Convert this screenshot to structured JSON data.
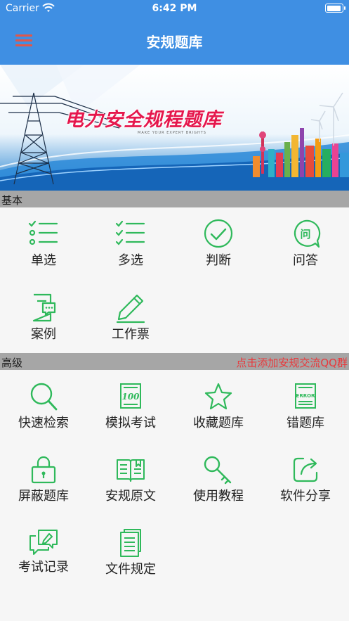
{
  "status_bar": {
    "carrier": "Carrier",
    "time": "6:42 PM",
    "battery_level": 0.95
  },
  "nav": {
    "title": "安规题库",
    "menu_icon": "hamburger-menu-icon"
  },
  "banner": {
    "title": "电力安全规程题库",
    "subtitle": "MAKE YOUR EXPERT BRIGHTS"
  },
  "colors": {
    "nav_blue": "#3f8fe3",
    "icon_green": "#2fb95b",
    "section_gray": "#a6a6a6",
    "link_red": "#e8393c"
  },
  "basic": {
    "header": "基本",
    "items": [
      {
        "label": "单选",
        "icon": "single-choice-list-icon"
      },
      {
        "label": "多选",
        "icon": "multi-choice-list-icon"
      },
      {
        "label": "判断",
        "icon": "check-circle-icon"
      },
      {
        "label": "问答",
        "icon": "question-bubble-icon"
      },
      {
        "label": "案例",
        "icon": "case-document-icon"
      },
      {
        "label": "工作票",
        "icon": "pencil-edit-icon"
      }
    ]
  },
  "advanced": {
    "header": "高级",
    "link": "点击添加安规交流QQ群",
    "items": [
      {
        "label": "快速检索",
        "icon": "search-icon"
      },
      {
        "label": "模拟考试",
        "icon": "exam-score-icon"
      },
      {
        "label": "收藏题库",
        "icon": "star-icon"
      },
      {
        "label": "错题库",
        "icon": "error-book-icon"
      },
      {
        "label": "屏蔽题库",
        "icon": "lock-icon"
      },
      {
        "label": "安规原文",
        "icon": "open-book-icon"
      },
      {
        "label": "使用教程",
        "icon": "key-icon"
      },
      {
        "label": "软件分享",
        "icon": "share-icon"
      },
      {
        "label": "考试记录",
        "icon": "chat-edit-icon"
      },
      {
        "label": "文件规定",
        "icon": "documents-icon"
      }
    ]
  }
}
